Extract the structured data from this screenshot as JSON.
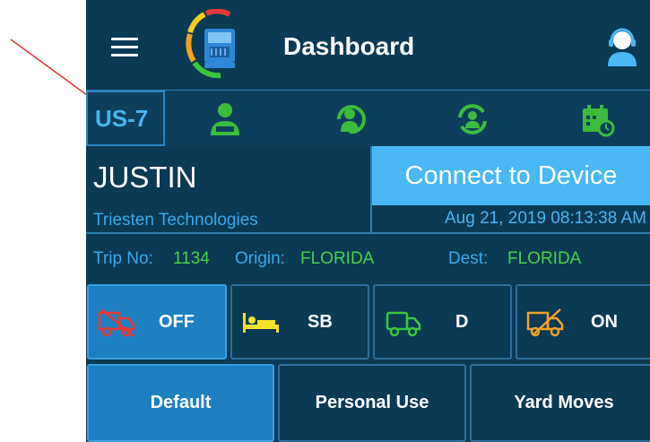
{
  "header": {
    "title": "Dashboard"
  },
  "statusbar": {
    "unit_label": "US-7"
  },
  "driver": {
    "name": "JUSTIN",
    "company": "Triesten Technologies",
    "connect_label": "Connect to Device",
    "datetime": "Aug 21, 2019 08:13:38 AM"
  },
  "trip": {
    "trip_label": "Trip No:",
    "trip_value": "1134",
    "origin_label": "Origin:",
    "origin_value": "FLORIDA",
    "dest_label": "Dest:",
    "dest_value": "FLORIDA"
  },
  "status_buttons": [
    {
      "label": "OFF",
      "icon": "truck-off-icon",
      "color": "#e53935",
      "active": true
    },
    {
      "label": "SB",
      "icon": "sleeper-bed-icon",
      "color": "#f5e12a",
      "active": false
    },
    {
      "label": "D",
      "icon": "truck-driving-icon",
      "color": "#3cc63c",
      "active": false
    },
    {
      "label": "ON",
      "icon": "truck-on-duty-icon",
      "color": "#f0a028",
      "active": false
    }
  ],
  "mode_buttons": [
    {
      "label": "Default",
      "active": true
    },
    {
      "label": "Personal Use",
      "active": false
    },
    {
      "label": "Yard Moves",
      "active": false
    }
  ],
  "colors": {
    "background": "#0b3a55",
    "accent": "#4ab8f5",
    "active_button": "#1e7fc0",
    "green_value": "#48d044",
    "status_icon_green": "#3dbb3d"
  }
}
